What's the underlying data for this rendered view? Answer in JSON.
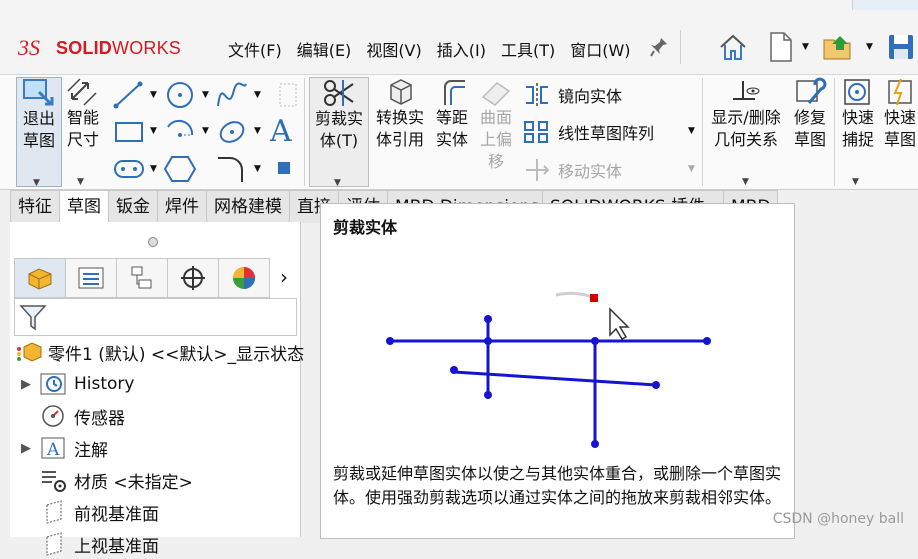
{
  "app": {
    "logo_prefix": "SOLID",
    "logo_suffix": "WORKS"
  },
  "menu": [
    "文件(F)",
    "编辑(E)",
    "视图(V)",
    "插入(I)",
    "工具(T)",
    "窗口(W)"
  ],
  "ribbon": {
    "exit_sketch": [
      "退出",
      "草图"
    ],
    "smart_dim": [
      "智能",
      "尺寸"
    ],
    "trim": [
      "剪裁实",
      "体(T)"
    ],
    "convert": [
      "转换实",
      "体引用"
    ],
    "offset": [
      "等距",
      "实体"
    ],
    "surface_offset": [
      "曲面",
      "上偏",
      "移"
    ],
    "mirror": "镜向实体",
    "linear_pattern": "线性草图阵列",
    "move": "移动实体",
    "show_delete": [
      "显示/删除",
      "几何关系"
    ],
    "repair": [
      "修复",
      "草图"
    ],
    "quick_snap": [
      "快速",
      "捕捉"
    ],
    "quick_sketch": [
      "快速",
      "草图"
    ],
    "text_tool": "A"
  },
  "tabs": [
    "特征",
    "草图",
    "钣金",
    "焊件",
    "网格建模",
    "直接",
    "评估",
    "MBD Dimensions",
    "SOLIDWORKS 插件",
    "MBD"
  ],
  "tree": [
    {
      "label": "零件1 (默认) <<默认>_显示状态",
      "icon": "part-icon",
      "expandable": false
    },
    {
      "label": "History",
      "icon": "history-icon",
      "expandable": true
    },
    {
      "label": "传感器",
      "icon": "sensor-icon",
      "expandable": false
    },
    {
      "label": "注解",
      "icon": "annotation-icon",
      "expandable": true
    },
    {
      "label": "材质 <未指定>",
      "icon": "material-icon",
      "expandable": false
    },
    {
      "label": "前视基准面",
      "icon": "plane-icon",
      "expandable": false
    },
    {
      "label": "上视基准面",
      "icon": "plane-icon",
      "expandable": false
    }
  ],
  "tooltip": {
    "title": "剪裁实体",
    "description": "剪裁或延伸草图实体以使之与其他实体重合，或删除一个草图实体。使用强劲剪裁选项以通过实体之间的拖放来剪裁相邻实体。"
  },
  "watermark": "CSDN @honey ball",
  "colors": {
    "brand": "#d71920",
    "sketch_line": "#1414d2",
    "trim_handle": "#d40000",
    "selected_tab": "#dfe8f1"
  }
}
